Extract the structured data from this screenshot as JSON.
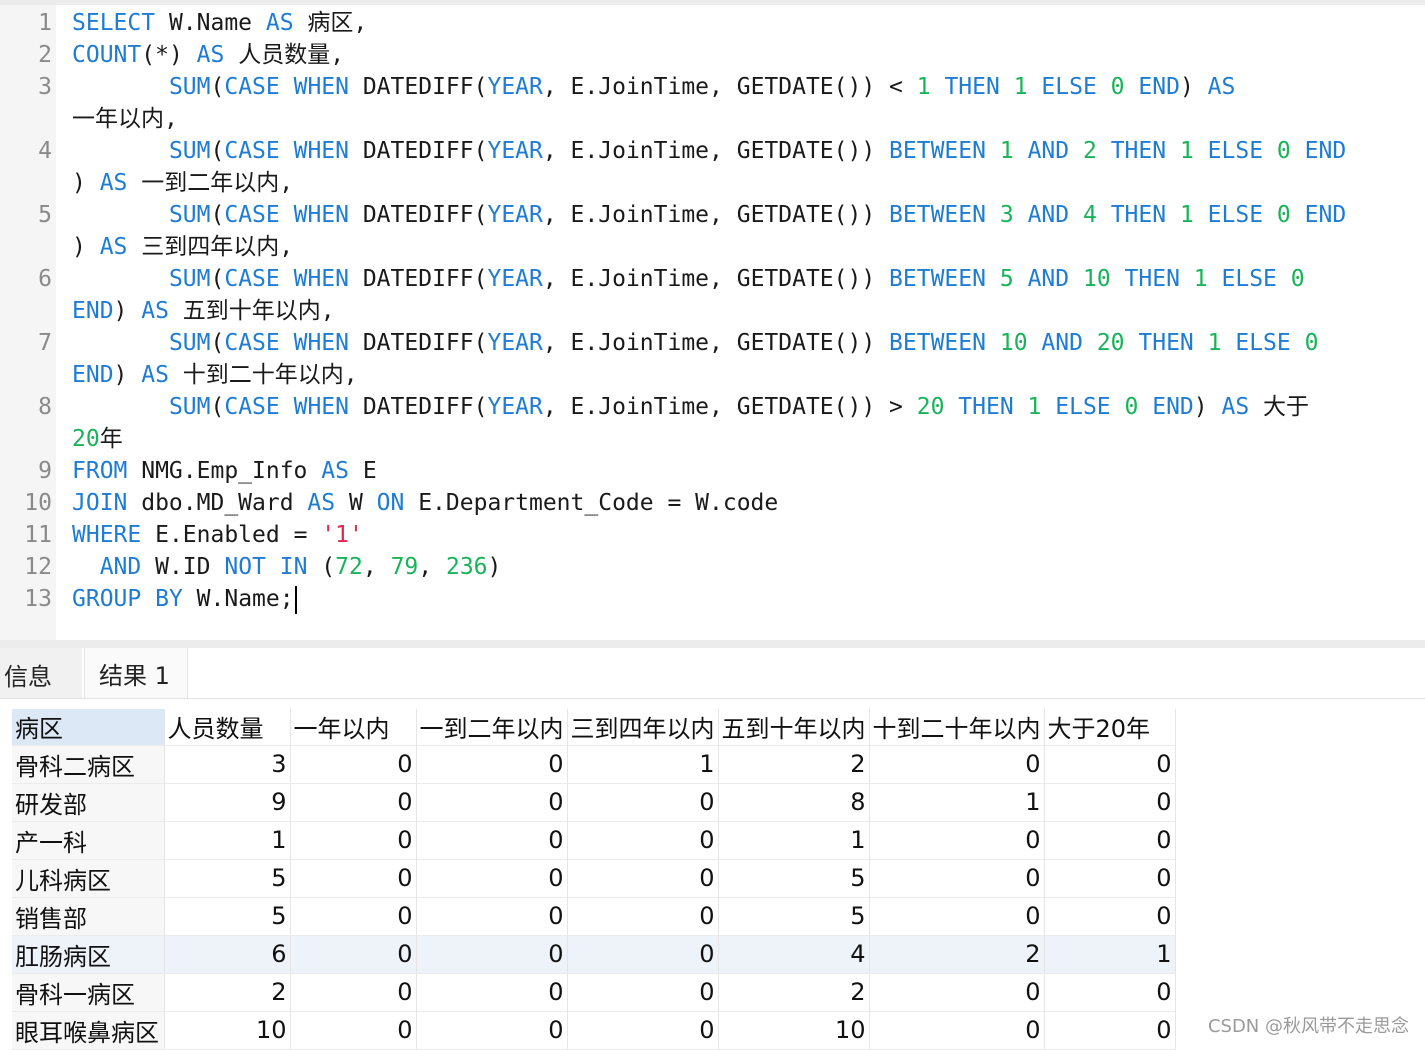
{
  "editor": {
    "lines": [
      {
        "n": "1",
        "segs": [
          [
            "kw",
            "SELECT"
          ],
          [
            "t",
            " W.Name "
          ],
          [
            "kw",
            "AS"
          ],
          [
            "t",
            " 病区,"
          ]
        ]
      },
      {
        "n": "2",
        "segs": [
          [
            "kw",
            "COUNT"
          ],
          [
            "t",
            "(*) "
          ],
          [
            "kw",
            "AS"
          ],
          [
            "t",
            " 人员数量,"
          ]
        ]
      },
      {
        "n": "3",
        "segs": [
          [
            "t",
            "       "
          ],
          [
            "kw",
            "SUM"
          ],
          [
            "t",
            "("
          ],
          [
            "kw",
            "CASE"
          ],
          [
            "t",
            " "
          ],
          [
            "kw",
            "WHEN"
          ],
          [
            "t",
            " DATEDIFF("
          ],
          [
            "kw",
            "YEAR"
          ],
          [
            "t",
            ", E.JoinTime, GETDATE()) < "
          ],
          [
            "num",
            "1"
          ],
          [
            "t",
            " "
          ],
          [
            "kw",
            "THEN"
          ],
          [
            "t",
            " "
          ],
          [
            "num",
            "1"
          ],
          [
            "t",
            " "
          ],
          [
            "kw",
            "ELSE"
          ],
          [
            "t",
            " "
          ],
          [
            "num",
            "0"
          ],
          [
            "t",
            " "
          ],
          [
            "kw",
            "END"
          ],
          [
            "t",
            ") "
          ],
          [
            "kw",
            "AS"
          ]
        ]
      },
      {
        "n": "",
        "segs": [
          [
            "t",
            "一年以内,"
          ]
        ]
      },
      {
        "n": "4",
        "segs": [
          [
            "t",
            "       "
          ],
          [
            "kw",
            "SUM"
          ],
          [
            "t",
            "("
          ],
          [
            "kw",
            "CASE"
          ],
          [
            "t",
            " "
          ],
          [
            "kw",
            "WHEN"
          ],
          [
            "t",
            " DATEDIFF("
          ],
          [
            "kw",
            "YEAR"
          ],
          [
            "t",
            ", E.JoinTime, GETDATE()) "
          ],
          [
            "kw",
            "BETWEEN"
          ],
          [
            "t",
            " "
          ],
          [
            "num",
            "1"
          ],
          [
            "t",
            " "
          ],
          [
            "kw",
            "AND"
          ],
          [
            "t",
            " "
          ],
          [
            "num",
            "2"
          ],
          [
            "t",
            " "
          ],
          [
            "kw",
            "THEN"
          ],
          [
            "t",
            " "
          ],
          [
            "num",
            "1"
          ],
          [
            "t",
            " "
          ],
          [
            "kw",
            "ELSE"
          ],
          [
            "t",
            " "
          ],
          [
            "num",
            "0"
          ],
          [
            "t",
            " "
          ],
          [
            "kw",
            "END"
          ]
        ]
      },
      {
        "n": "",
        "segs": [
          [
            "t",
            ") "
          ],
          [
            "kw",
            "AS"
          ],
          [
            "t",
            " 一到二年以内,"
          ]
        ]
      },
      {
        "n": "5",
        "segs": [
          [
            "t",
            "       "
          ],
          [
            "kw",
            "SUM"
          ],
          [
            "t",
            "("
          ],
          [
            "kw",
            "CASE"
          ],
          [
            "t",
            " "
          ],
          [
            "kw",
            "WHEN"
          ],
          [
            "t",
            " DATEDIFF("
          ],
          [
            "kw",
            "YEAR"
          ],
          [
            "t",
            ", E.JoinTime, GETDATE()) "
          ],
          [
            "kw",
            "BETWEEN"
          ],
          [
            "t",
            " "
          ],
          [
            "num",
            "3"
          ],
          [
            "t",
            " "
          ],
          [
            "kw",
            "AND"
          ],
          [
            "t",
            " "
          ],
          [
            "num",
            "4"
          ],
          [
            "t",
            " "
          ],
          [
            "kw",
            "THEN"
          ],
          [
            "t",
            " "
          ],
          [
            "num",
            "1"
          ],
          [
            "t",
            " "
          ],
          [
            "kw",
            "ELSE"
          ],
          [
            "t",
            " "
          ],
          [
            "num",
            "0"
          ],
          [
            "t",
            " "
          ],
          [
            "kw",
            "END"
          ]
        ]
      },
      {
        "n": "",
        "segs": [
          [
            "t",
            ") "
          ],
          [
            "kw",
            "AS"
          ],
          [
            "t",
            " 三到四年以内,"
          ]
        ]
      },
      {
        "n": "6",
        "segs": [
          [
            "t",
            "       "
          ],
          [
            "kw",
            "SUM"
          ],
          [
            "t",
            "("
          ],
          [
            "kw",
            "CASE"
          ],
          [
            "t",
            " "
          ],
          [
            "kw",
            "WHEN"
          ],
          [
            "t",
            " DATEDIFF("
          ],
          [
            "kw",
            "YEAR"
          ],
          [
            "t",
            ", E.JoinTime, GETDATE()) "
          ],
          [
            "kw",
            "BETWEEN"
          ],
          [
            "t",
            " "
          ],
          [
            "num",
            "5"
          ],
          [
            "t",
            " "
          ],
          [
            "kw",
            "AND"
          ],
          [
            "t",
            " "
          ],
          [
            "num",
            "10"
          ],
          [
            "t",
            " "
          ],
          [
            "kw",
            "THEN"
          ],
          [
            "t",
            " "
          ],
          [
            "num",
            "1"
          ],
          [
            "t",
            " "
          ],
          [
            "kw",
            "ELSE"
          ],
          [
            "t",
            " "
          ],
          [
            "num",
            "0"
          ]
        ]
      },
      {
        "n": "",
        "segs": [
          [
            "kw",
            "END"
          ],
          [
            "t",
            ") "
          ],
          [
            "kw",
            "AS"
          ],
          [
            "t",
            " 五到十年以内,"
          ]
        ]
      },
      {
        "n": "7",
        "segs": [
          [
            "t",
            "       "
          ],
          [
            "kw",
            "SUM"
          ],
          [
            "t",
            "("
          ],
          [
            "kw",
            "CASE"
          ],
          [
            "t",
            " "
          ],
          [
            "kw",
            "WHEN"
          ],
          [
            "t",
            " DATEDIFF("
          ],
          [
            "kw",
            "YEAR"
          ],
          [
            "t",
            ", E.JoinTime, GETDATE()) "
          ],
          [
            "kw",
            "BETWEEN"
          ],
          [
            "t",
            " "
          ],
          [
            "num",
            "10"
          ],
          [
            "t",
            " "
          ],
          [
            "kw",
            "AND"
          ],
          [
            "t",
            " "
          ],
          [
            "num",
            "20"
          ],
          [
            "t",
            " "
          ],
          [
            "kw",
            "THEN"
          ],
          [
            "t",
            " "
          ],
          [
            "num",
            "1"
          ],
          [
            "t",
            " "
          ],
          [
            "kw",
            "ELSE"
          ],
          [
            "t",
            " "
          ],
          [
            "num",
            "0"
          ]
        ]
      },
      {
        "n": "",
        "segs": [
          [
            "kw",
            "END"
          ],
          [
            "t",
            ") "
          ],
          [
            "kw",
            "AS"
          ],
          [
            "t",
            " 十到二十年以内,"
          ]
        ]
      },
      {
        "n": "8",
        "segs": [
          [
            "t",
            "       "
          ],
          [
            "kw",
            "SUM"
          ],
          [
            "t",
            "("
          ],
          [
            "kw",
            "CASE"
          ],
          [
            "t",
            " "
          ],
          [
            "kw",
            "WHEN"
          ],
          [
            "t",
            " DATEDIFF("
          ],
          [
            "kw",
            "YEAR"
          ],
          [
            "t",
            ", E.JoinTime, GETDATE()) > "
          ],
          [
            "num",
            "20"
          ],
          [
            "t",
            " "
          ],
          [
            "kw",
            "THEN"
          ],
          [
            "t",
            " "
          ],
          [
            "num",
            "1"
          ],
          [
            "t",
            " "
          ],
          [
            "kw",
            "ELSE"
          ],
          [
            "t",
            " "
          ],
          [
            "num",
            "0"
          ],
          [
            "t",
            " "
          ],
          [
            "kw",
            "END"
          ],
          [
            "t",
            ") "
          ],
          [
            "kw",
            "AS"
          ],
          [
            "t",
            " 大于"
          ]
        ]
      },
      {
        "n": "",
        "segs": [
          [
            "num",
            "20"
          ],
          [
            "t",
            "年"
          ]
        ]
      },
      {
        "n": "9",
        "segs": [
          [
            "kw",
            "FROM"
          ],
          [
            "t",
            " NMG.Emp_Info "
          ],
          [
            "kw",
            "AS"
          ],
          [
            "t",
            " E"
          ]
        ]
      },
      {
        "n": "10",
        "segs": [
          [
            "kw",
            "JOIN"
          ],
          [
            "t",
            " dbo.MD_Ward "
          ],
          [
            "kw",
            "AS"
          ],
          [
            "t",
            " W "
          ],
          [
            "kw",
            "ON"
          ],
          [
            "t",
            " E.Department_Code = W.code"
          ]
        ]
      },
      {
        "n": "11",
        "segs": [
          [
            "kw",
            "WHERE"
          ],
          [
            "t",
            " E.Enabled = "
          ],
          [
            "str",
            "'1'"
          ]
        ]
      },
      {
        "n": "12",
        "segs": [
          [
            "t",
            "  "
          ],
          [
            "kw",
            "AND"
          ],
          [
            "t",
            " W.ID "
          ],
          [
            "kw",
            "NOT"
          ],
          [
            "t",
            " "
          ],
          [
            "kw",
            "IN"
          ],
          [
            "t",
            " ("
          ],
          [
            "num",
            "72"
          ],
          [
            "t",
            ", "
          ],
          [
            "num",
            "79"
          ],
          [
            "t",
            ", "
          ],
          [
            "num",
            "236"
          ],
          [
            "t",
            ")"
          ]
        ]
      },
      {
        "n": "13",
        "segs": [
          [
            "kw",
            "GROUP"
          ],
          [
            "t",
            " "
          ],
          [
            "kw",
            "BY"
          ],
          [
            "t",
            " W.Name;"
          ]
        ]
      }
    ]
  },
  "tabs": {
    "info": "信息",
    "result": "结果 1"
  },
  "results": {
    "columns": [
      "病区",
      "人员数量",
      "一年以内",
      "一到二年以内",
      "三到四年以内",
      "五到十年以内",
      "十到二十年以内",
      "大于20年"
    ],
    "rows": [
      [
        "骨科二病区",
        "3",
        "0",
        "0",
        "1",
        "2",
        "0",
        "0"
      ],
      [
        "研发部",
        "9",
        "0",
        "0",
        "0",
        "8",
        "1",
        "0"
      ],
      [
        "产一科",
        "1",
        "0",
        "0",
        "0",
        "1",
        "0",
        "0"
      ],
      [
        "儿科病区",
        "5",
        "0",
        "0",
        "0",
        "5",
        "0",
        "0"
      ],
      [
        "销售部",
        "5",
        "0",
        "0",
        "0",
        "5",
        "0",
        "0"
      ],
      [
        "肛肠病区",
        "6",
        "0",
        "0",
        "0",
        "4",
        "2",
        "1"
      ],
      [
        "骨科一病区",
        "2",
        "0",
        "0",
        "0",
        "2",
        "0",
        "0"
      ],
      [
        "眼耳喉鼻病区",
        "10",
        "0",
        "0",
        "0",
        "10",
        "0",
        "0"
      ]
    ]
  },
  "watermark": "CSDN @秋风带不走思念",
  "colors": {
    "keyword": "#1f7cd4",
    "number": "#19b35a",
    "string": "#e0264f",
    "line_number": "#8a8a8a"
  }
}
